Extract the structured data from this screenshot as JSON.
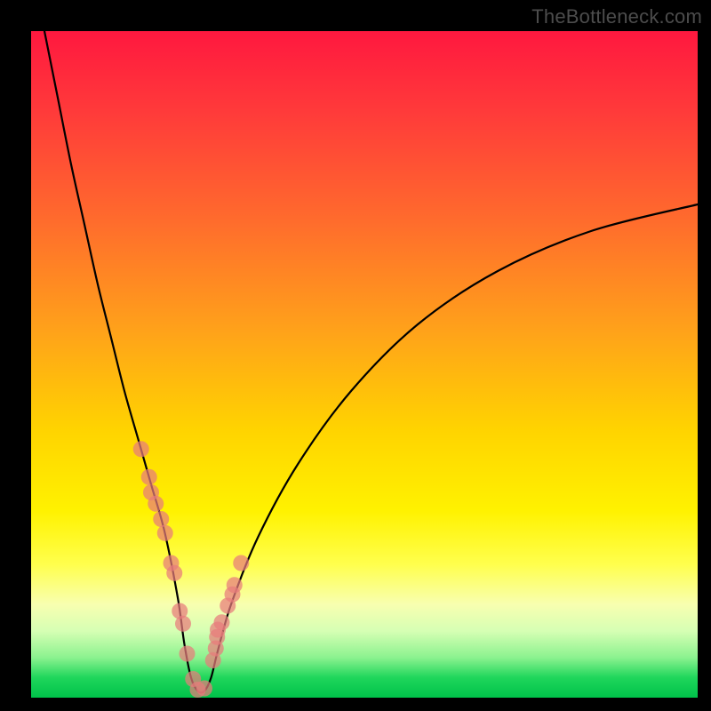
{
  "watermark": "TheBottleneck.com",
  "chart_data": {
    "type": "line",
    "title": "",
    "xlabel": "",
    "ylabel": "",
    "xlim": [
      0,
      100
    ],
    "ylim": [
      0,
      100
    ],
    "grid": false,
    "description": "Bottleneck curve showing mismatch cost vs. component balance ratio. Minimum (zero bottleneck, green zone) occurs near x≈25; cost rises steeply on the left (component too weak) and more gradually on the right (component too strong).",
    "series": [
      {
        "name": "bottleneck-curve",
        "x": [
          2,
          4,
          6,
          8,
          10,
          12,
          14,
          16,
          18,
          20,
          22,
          23,
          24,
          25,
          26,
          27,
          28,
          30,
          34,
          40,
          48,
          58,
          70,
          84,
          100
        ],
        "y": [
          100,
          90,
          80,
          71,
          62,
          54,
          46,
          39,
          32,
          25,
          15,
          8,
          3,
          1,
          1,
          3,
          7,
          14,
          24,
          35,
          46,
          56,
          64,
          70,
          74
        ]
      }
    ],
    "marked_points": {
      "name": "sample-dots",
      "comment": "Salmon dots clustered along both branches near the valley minimum",
      "x": [
        16.5,
        17.7,
        18.0,
        18.7,
        19.5,
        20.1,
        21.0,
        21.5,
        22.3,
        22.8,
        23.4,
        24.3,
        25.0,
        26.0,
        27.3,
        27.7,
        27.9,
        28.0,
        28.6,
        29.5,
        30.2,
        30.5,
        31.5
      ],
      "y": [
        37.3,
        33.1,
        30.8,
        29.1,
        26.8,
        24.7,
        20.2,
        18.7,
        13.0,
        11.1,
        6.6,
        2.8,
        1.2,
        1.4,
        5.6,
        7.4,
        9.1,
        10.2,
        11.3,
        13.8,
        15.5,
        16.9,
        20.2
      ]
    },
    "background_gradient": {
      "top_color": "#ff183f",
      "bottom_color": "#00c24a",
      "meaning": "Red at top = high bottleneck, green at bottom = no bottleneck"
    }
  }
}
